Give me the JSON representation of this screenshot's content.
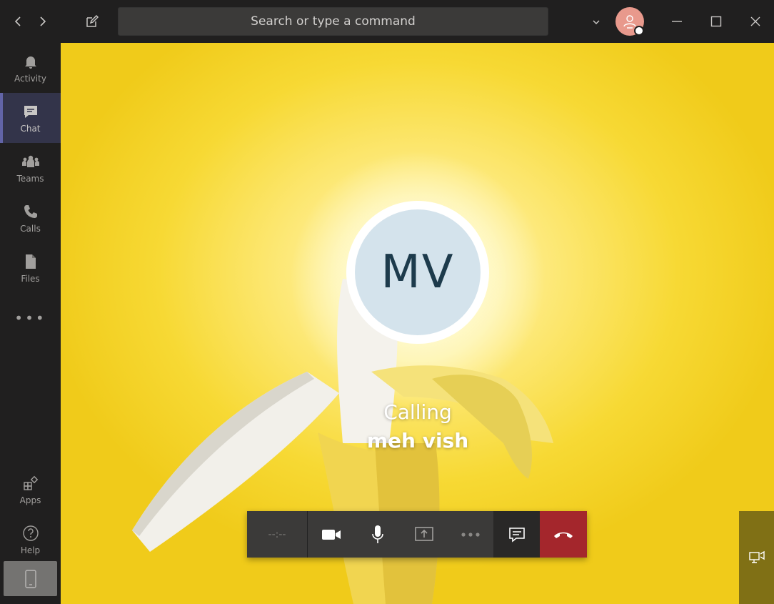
{
  "search": {
    "placeholder": "Search or type a command"
  },
  "rail": {
    "items": [
      {
        "label": "Activity",
        "icon": "bell-icon"
      },
      {
        "label": "Chat",
        "icon": "chat-icon",
        "active": true
      },
      {
        "label": "Teams",
        "icon": "teams-icon"
      },
      {
        "label": "Calls",
        "icon": "phone-icon"
      },
      {
        "label": "Files",
        "icon": "file-icon"
      }
    ],
    "more": "•••",
    "bottom": [
      {
        "label": "Apps",
        "icon": "apps-icon"
      },
      {
        "label": "Help",
        "icon": "help-icon"
      }
    ]
  },
  "call": {
    "avatar_initials": "MV",
    "status": "Calling",
    "callee": "meh vish",
    "timer": "--:--"
  },
  "colors": {
    "accent": "#6264a7",
    "hangup": "#a4262c",
    "avatar_bg": "#d4e3ec",
    "user_avatar": "#e8998c"
  }
}
